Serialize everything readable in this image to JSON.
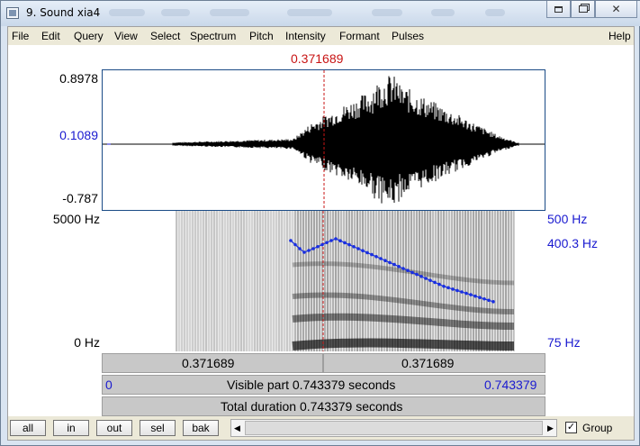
{
  "window": {
    "title": "9. Sound xia4"
  },
  "menu": [
    "File",
    "Edit",
    "Query",
    "View",
    "Select",
    "Spectrum",
    "Pitch",
    "Intensity",
    "Formant",
    "Pulses",
    "Help"
  ],
  "cursor_time": "0.371689",
  "waveform": {
    "y_max": "0.8978",
    "y_cursor": "0.1089",
    "y_min": "-0.787"
  },
  "spectrogram": {
    "y_top": "5000 Hz",
    "y_bottom": "0 Hz",
    "pitch_top": "500 Hz",
    "pitch_cursor": "400.3 Hz",
    "pitch_bottom": "75 Hz"
  },
  "time_bars": {
    "left_part": "0.371689",
    "right_part": "0.371689",
    "visible_start": "0",
    "visible_label": "Visible part 0.743379 seconds",
    "visible_end": "0.743379",
    "total_label": "Total duration 0.743379 seconds"
  },
  "buttons": {
    "all": "all",
    "in": "in",
    "out": "out",
    "sel": "sel",
    "bak": "bak"
  },
  "group": {
    "label": "Group",
    "checked": "✓"
  },
  "colors": {
    "cursor": "#c81414",
    "axis_blue": "#1a1ad0",
    "pitch": "#1a2fe0",
    "frame": "#1a4b86"
  }
}
